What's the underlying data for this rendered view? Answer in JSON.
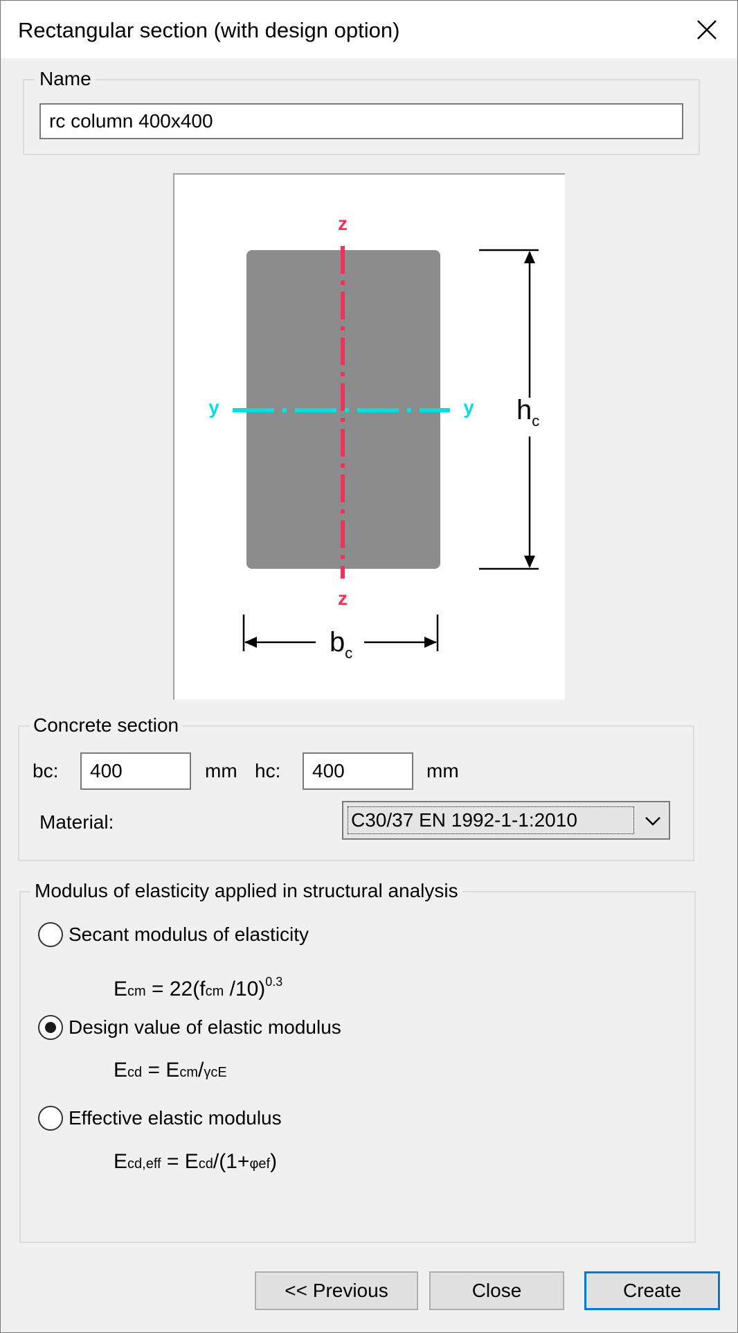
{
  "window": {
    "title": "Rectangular section (with design option)"
  },
  "name_group": {
    "legend": "Name",
    "value": "rc column 400x400"
  },
  "diagram": {
    "axis_y": "y",
    "axis_z": "z",
    "dim_b": "b",
    "dim_b_sub": "c",
    "dim_h": "h",
    "dim_h_sub": "c",
    "colors": {
      "section_fill": "#8c8c8c",
      "z_axis": "#f0325a",
      "y_axis": "#00e0e0"
    }
  },
  "concrete_group": {
    "legend": "Concrete section",
    "bc_label": "bc:",
    "bc_value": "400",
    "bc_unit": "mm",
    "hc_label": "hc:",
    "hc_value": "400",
    "hc_unit": "mm",
    "material_label": "Material:",
    "material_value": "C30/37 EN 1992-1-1:2010"
  },
  "modulus_group": {
    "legend": "Modulus of elasticity applied in structural analysis",
    "options": [
      {
        "label": "Secant modulus of elasticity",
        "checked": false,
        "formula": {
          "a": "E",
          "a_sub": "cm",
          "b": " = 22(f",
          "b_sub": "cm",
          "c": " /10)",
          "sup": "0.3"
        }
      },
      {
        "label": "Design value of elastic modulus",
        "checked": true,
        "formula": {
          "a": "E",
          "a_sub": "cd",
          "b": " = E",
          "b_sub": "cm",
          "c": "/",
          "c_sub": "γcE"
        }
      },
      {
        "label": "Effective elastic modulus",
        "checked": false,
        "formula": {
          "a": "E",
          "a_sub": "cd,eff",
          "b": " = E",
          "b_sub": "cd",
          "c": "/(1+",
          "c_sub": "φef",
          "d": ")"
        }
      }
    ]
  },
  "buttons": {
    "previous": "<< Previous",
    "close": "Close",
    "create": "Create"
  },
  "icons": {
    "close": "close-icon",
    "dropdown": "chevron-down-icon"
  }
}
